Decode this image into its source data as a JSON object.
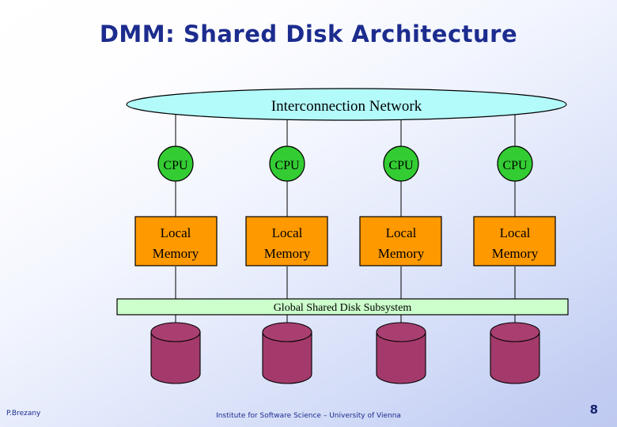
{
  "slide": {
    "title": "DMM: Shared Disk Architecture",
    "title_color": "#1c2c8e",
    "background_from": "#ffffff",
    "background_to": "#bfcaf1"
  },
  "diagram": {
    "network": {
      "label": "Interconnection Network",
      "fill": "#b3fbfb",
      "stroke": "#000000"
    },
    "bus": {
      "label": "Global Shared Disk Subsystem",
      "fill": "#ccffcc",
      "stroke": "#000000"
    },
    "node_colors": {
      "cpu_fill": "#33cc33",
      "memory_fill": "#ff9900",
      "disk_fill": "#a33a6b",
      "disk_top_fill": "#a83f70",
      "stroke": "#000000"
    },
    "nodes": [
      {
        "cpu": "CPU",
        "memory_line1": "Local",
        "memory_line2": "Memory"
      },
      {
        "cpu": "CPU",
        "memory_line1": "Local",
        "memory_line2": "Memory"
      },
      {
        "cpu": "CPU",
        "memory_line1": "Local",
        "memory_line2": "Memory"
      },
      {
        "cpu": "CPU",
        "memory_line1": "Local",
        "memory_line2": "Memory"
      }
    ]
  },
  "footer": {
    "author": "P.Brezany",
    "institute": "Institute for Software Science – University of Vienna",
    "page_number": "8"
  }
}
